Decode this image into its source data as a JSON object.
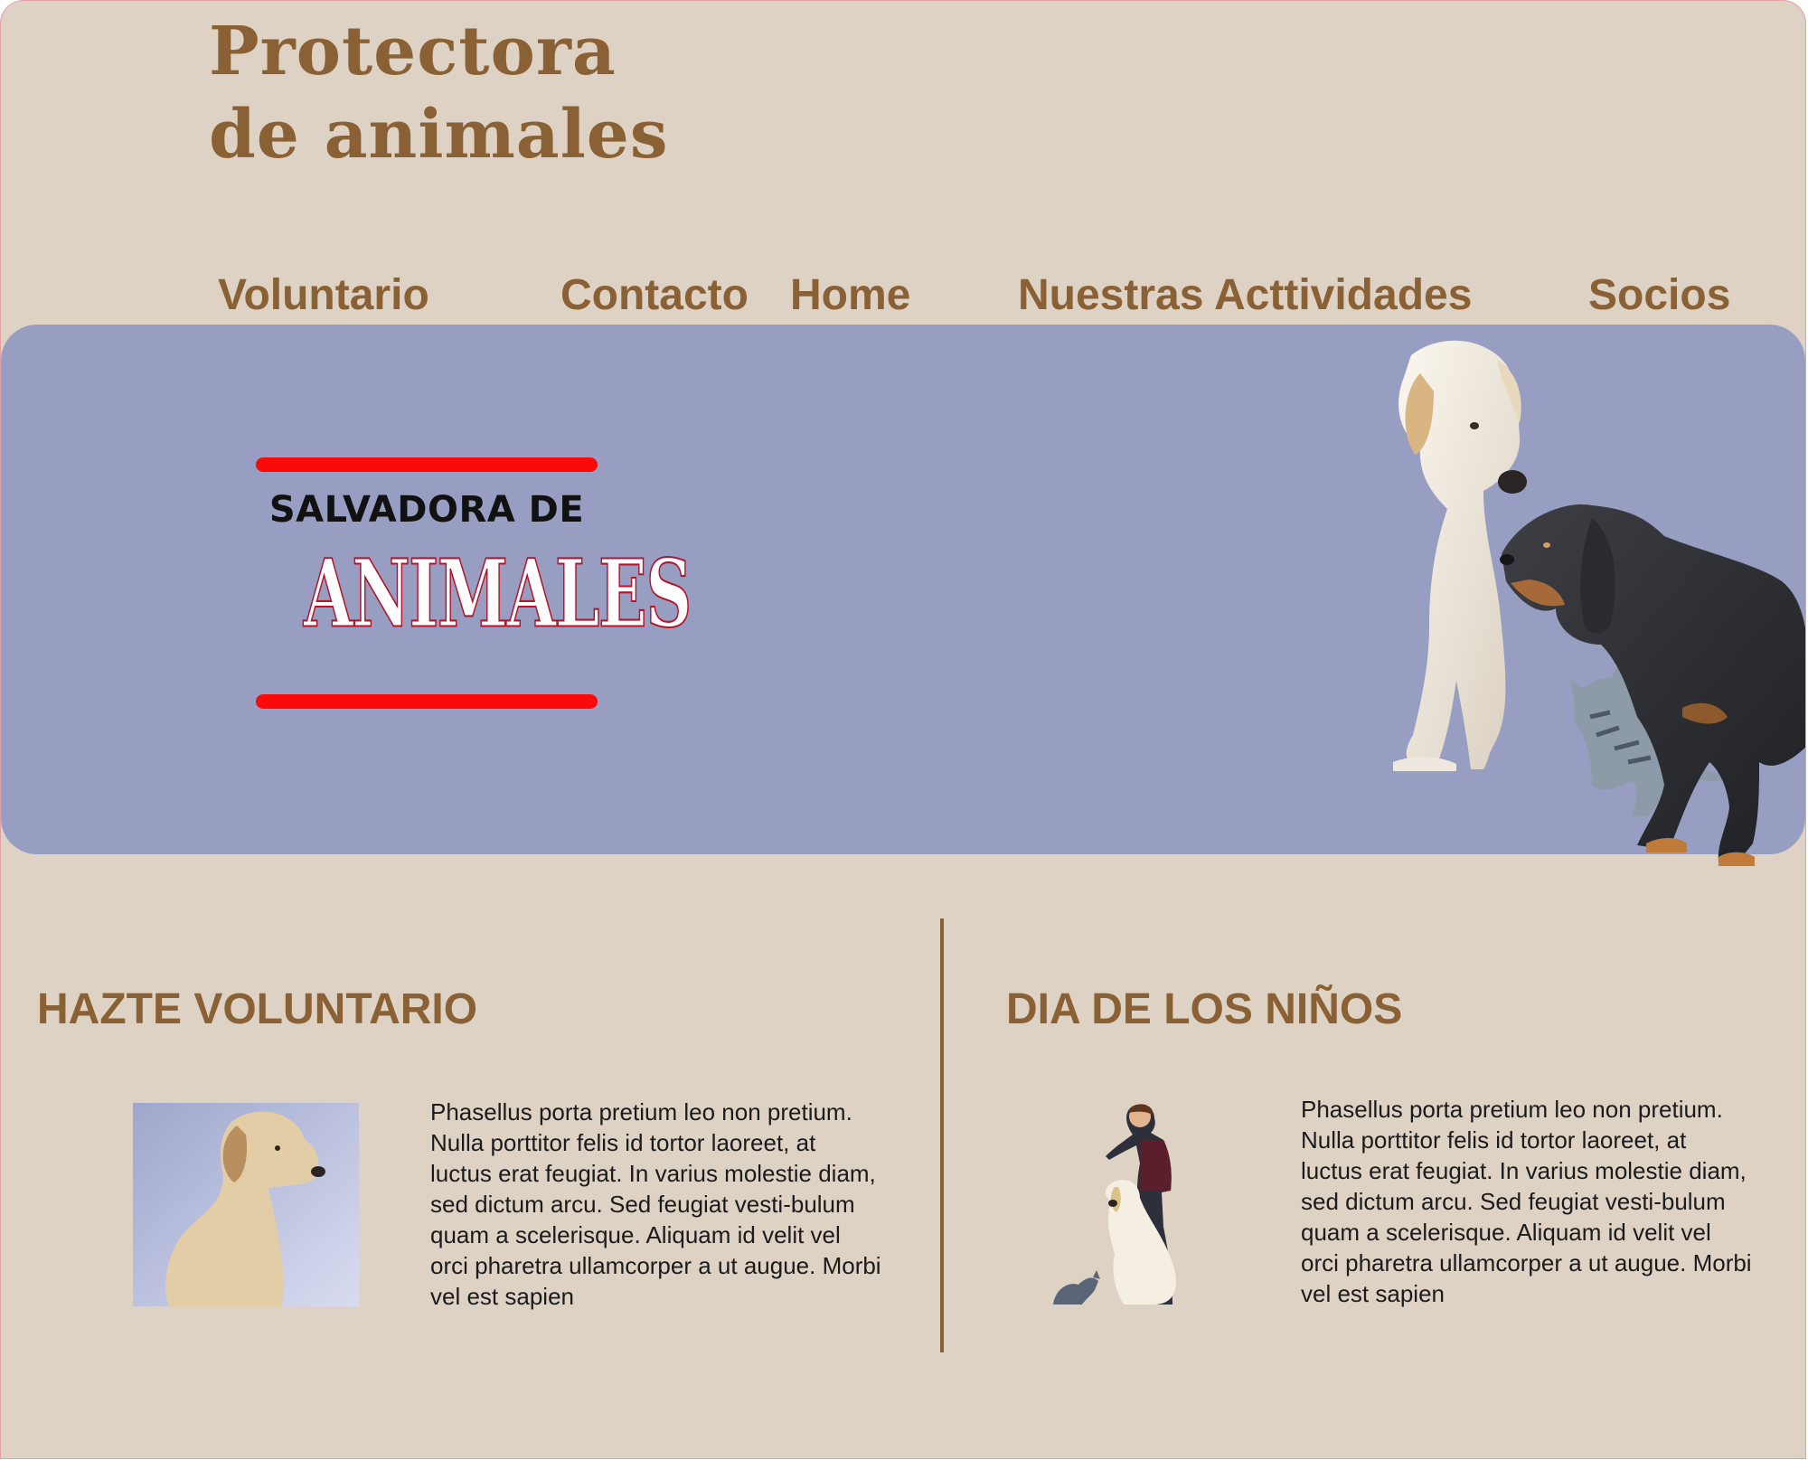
{
  "header": {
    "title_line1": "Protectora",
    "title_line2": "de animales"
  },
  "nav": {
    "items": [
      {
        "label": "Voluntario"
      },
      {
        "label": "Contacto"
      },
      {
        "label": "Home"
      },
      {
        "label": "Nuestras Acttividades"
      },
      {
        "label": "Socios"
      }
    ]
  },
  "banner": {
    "logo_line1": "SALVADORA DE",
    "logo_line2": "ANIMALES",
    "logo_bar_color": "#fb0a0a",
    "background_color": "#979ec2"
  },
  "sections": [
    {
      "title": "HAZTE VOLUNTARIO",
      "text": " Phasellus porta pretium leo non pretium. Nulla porttitor felis id tortor laoreet, at luctus erat feugiat. In varius molestie diam, sed dictum arcu. Sed feugiat vesti-bulum quam a scelerisque. Aliquam id velit vel orci pharetra ullamcorper a ut augue. Morbi vel est sapien"
    },
    {
      "title": "DIA DE LOS NIÑOS",
      "text": " Phasellus porta pretium leo non pretium. Nulla porttitor felis id tortor laoreet, at luctus erat feugiat. In varius molestie diam, sed dictum arcu. Sed feugiat vesti-bulum quam a scelerisque. Aliquam id velit vel orci pharetra ullamcorper a ut augue. Morbi vel est sapien"
    }
  ],
  "colors": {
    "page_background": "#ded2c4",
    "accent_brown": "#8a6035",
    "text": "#1b1b1b"
  }
}
